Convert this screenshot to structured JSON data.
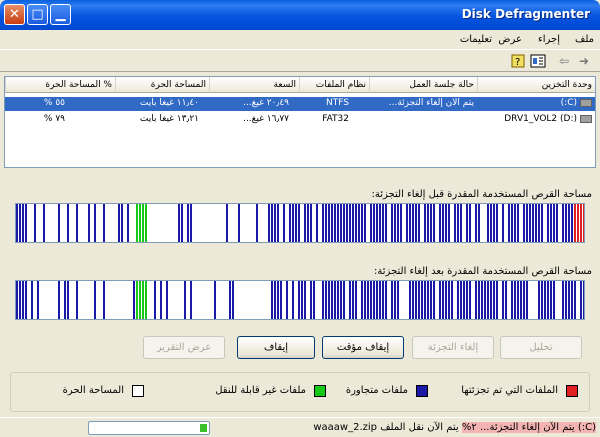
{
  "window": {
    "title": "Disk Defragmenter",
    "close_glyph": "✕",
    "max_glyph": "□",
    "min_glyph": "▁"
  },
  "menu": {
    "file": "ملف",
    "action": "إجراء",
    "view": "عرض",
    "help": "تعليمات"
  },
  "toolbar": {
    "icons": [
      "back-icon",
      "forward-icon",
      "properties-icon",
      "help-icon"
    ]
  },
  "volumes": {
    "headers": [
      "وحدة التخزين",
      "حالة جلسة العمل",
      "نظام الملفات",
      "السعة",
      "المساحة الحرة",
      "% المساحة الحرة"
    ],
    "rows": [
      {
        "volume": "(C:)",
        "status": "يتم الآن إلغاء التجزئة...",
        "fs": "NTFS",
        "capacity": "٢٠٫٤٩ غيغ...",
        "free": "١١٫٤٠ غيغا بايت",
        "pct": "٥٥ %",
        "selected": true
      },
      {
        "volume": "DRV1_VOL2 (D:)",
        "status": "",
        "fs": "FAT32",
        "capacity": "١٦٫٧٧ غيغ...",
        "free": "١٣٫٢١ غيغا بايت",
        "pct": "٧٩ %",
        "selected": false
      }
    ]
  },
  "maps": {
    "before_label": "مساحة القرص المستخدمة المقدرة قبل إلغاء التجزئة:",
    "after_label": "مساحة القرص المستخدمة المقدرة بعد إلغاء التجزئة:"
  },
  "buttons": {
    "analyze": "تحليل",
    "defragment": "إلغاء التجزئة",
    "pause": "إيقاف مؤقت",
    "stop": "إيقاف",
    "view_report": "عرض التقرير"
  },
  "legend": {
    "fragmented": "الملفات التي تم تجزئتها",
    "contiguous": "ملفات متجاورة",
    "unmovable": "ملفات غير قابلة للنقل",
    "free": "المساحة الحرة",
    "colors": {
      "fragmented": "#e02020",
      "contiguous": "#1a1aa6",
      "unmovable": "#18c818",
      "free": "#ffffff"
    }
  },
  "status": {
    "highlight": "(C:) يتم الآن إلغاء التجزئة... ٢%",
    "text": " يتم الآن نقل الملف waaaw_2.zip",
    "progress_percent": 2
  }
}
